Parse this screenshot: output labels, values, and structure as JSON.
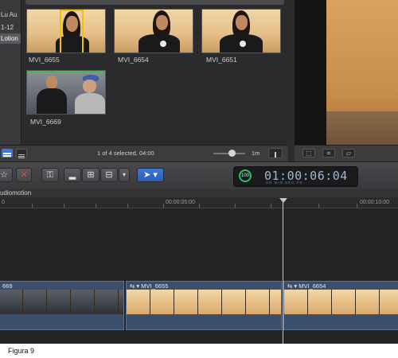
{
  "sidebar": {
    "items": [
      {
        "label": "Lu Au",
        "selected": false
      },
      {
        "label": "1-12",
        "selected": false
      },
      {
        "label": "Lotion",
        "selected": true
      }
    ]
  },
  "browser": {
    "event_title": "",
    "clips": [
      {
        "name": "MVI_6655",
        "selected": true
      },
      {
        "name": "MVI_6654",
        "selected": false
      },
      {
        "name": "MVI_6651",
        "selected": false
      },
      {
        "name": "MVI_6669",
        "selected": false
      }
    ],
    "status": "1 of 4 selected, 04:00",
    "zoom_label": "1m"
  },
  "toolbar": {
    "timecode": "01:00:06:04",
    "timecode_units": "HR  MIN  SEC  FR",
    "progress": "100"
  },
  "timeline": {
    "project_name": "udiomotion",
    "ruler": [
      "0",
      "00:00:05:00",
      "00:00:10:00"
    ],
    "clips": [
      {
        "name": "669"
      },
      {
        "name": "MVI_6655"
      },
      {
        "name": "MVI_6654"
      }
    ]
  },
  "caption": "Figura 9",
  "colors": {
    "selection": "#f2c200",
    "clip_blue": "#3b4e6a",
    "accent_blue": "#3f78d8",
    "green": "#3fbf4a"
  }
}
